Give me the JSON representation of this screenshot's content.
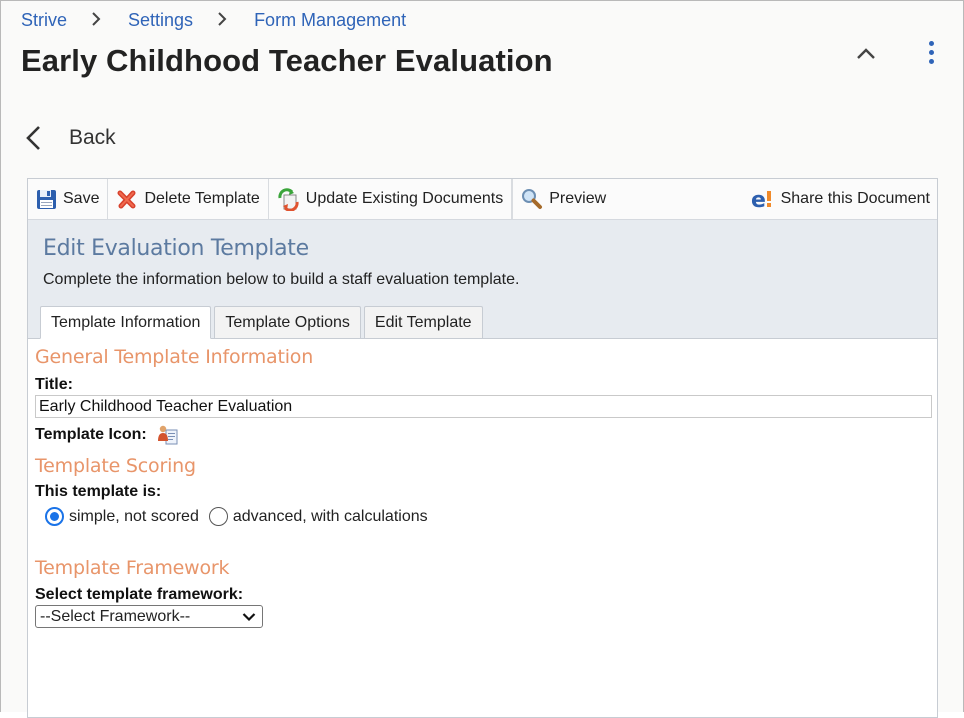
{
  "breadcrumb": {
    "items": [
      "Strive",
      "Settings",
      "Form Management"
    ]
  },
  "page": {
    "title": "Early Childhood Teacher Evaluation",
    "back_label": "Back"
  },
  "toolbar": {
    "save_label": "Save",
    "delete_label": "Delete Template",
    "update_label": "Update Existing Documents",
    "preview_label": "Preview",
    "share_label": "Share this Document"
  },
  "editor": {
    "heading": "Edit Evaluation Template",
    "description": "Complete the information below to build a staff evaluation template.",
    "tabs": [
      {
        "label": "Template Information",
        "active": true
      },
      {
        "label": "Template Options",
        "active": false
      },
      {
        "label": "Edit Template",
        "active": false
      }
    ]
  },
  "general": {
    "heading": "General Template Information",
    "title_label": "Title:",
    "title_value": "Early Childhood Teacher Evaluation",
    "icon_label": "Template Icon:"
  },
  "scoring": {
    "heading": "Template Scoring",
    "label": "This template is:",
    "options": [
      {
        "label": "simple, not scored",
        "checked": true
      },
      {
        "label": "advanced, with calculations",
        "checked": false
      }
    ]
  },
  "framework": {
    "heading": "Template Framework",
    "label": "Select template framework:",
    "selected": "--Select Framework--"
  },
  "colors": {
    "link": "#2f64b8",
    "section_heading": "#5c7aa0",
    "orange_heading": "#e8956a",
    "radio_accent": "#1a73e8"
  }
}
